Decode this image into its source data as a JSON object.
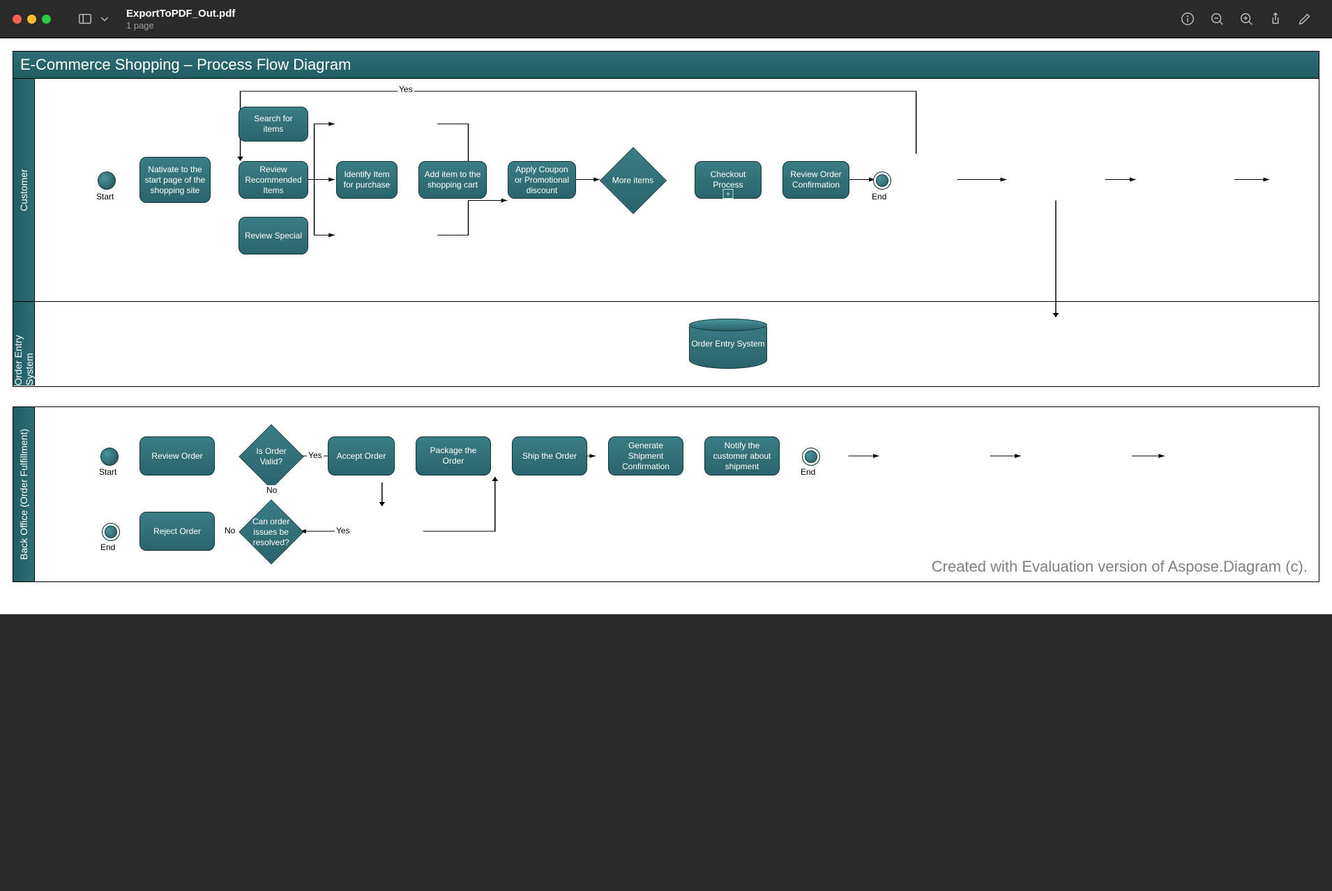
{
  "window": {
    "filename": "ExportToPDF_Out.pdf",
    "page_count_label": "1 page"
  },
  "diagram": {
    "title": "E-Commerce Shopping – Process Flow Diagram",
    "lanes": {
      "customer": {
        "label": "Customer",
        "start": "Start",
        "end": "End"
      },
      "oes": {
        "label": "Order Entry System"
      },
      "back": {
        "label": "Back Office (Order Fulfillment)",
        "start": "Start",
        "end": "End",
        "end2": "End"
      }
    },
    "nodes": {
      "navigate": "Nativate to the start page of the shopping site",
      "search": "Search for items",
      "recommend": "Review Recommended Items",
      "special": "Review Special",
      "identify": "Identify Item for purchase",
      "addcart": "Add item to the shopping cart",
      "coupon": "Apply Coupon or Promotional discount",
      "moreitems": "More items",
      "checkout": "Checkout Process",
      "revconf": "Review Order Confirmation",
      "oes_db": "Order Entry System",
      "bo_review": "Review Order",
      "bo_valid": "Is Order Valid?",
      "bo_accept": "Accept Order",
      "bo_package": "Package the Order",
      "bo_ship": "Ship the Order",
      "bo_genconf": "Generate Shipment Confirmation",
      "bo_notify": "Notify the customer about shipment",
      "bo_resolve": "Can order issues be resolved?",
      "bo_reject": "Reject Order"
    },
    "edge_labels": {
      "yes": "Yes",
      "no": "No"
    },
    "watermark": "Created with Evaluation version of Aspose.Diagram (c)."
  }
}
